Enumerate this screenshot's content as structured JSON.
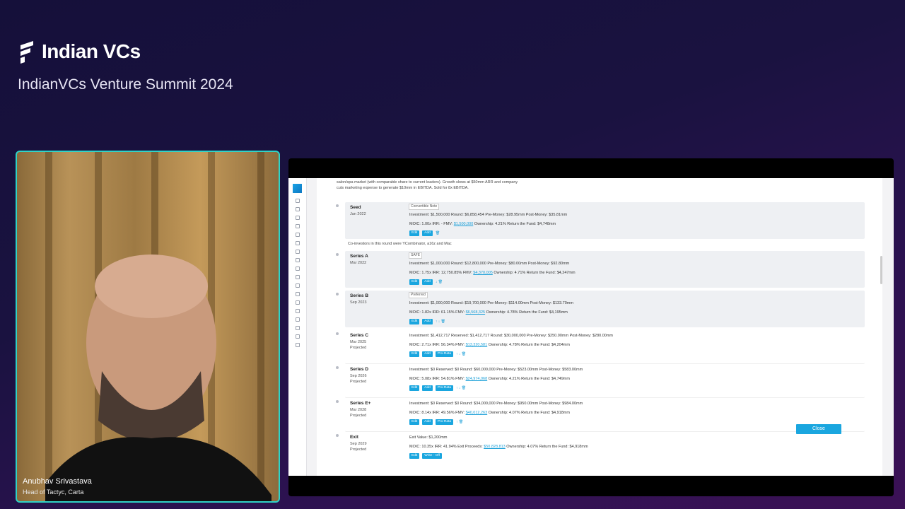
{
  "event": {
    "brand": "Indian VCs",
    "title": "IndianVCs Venture Summit 2024"
  },
  "speaker": {
    "name": "Anubhav Srivastava",
    "role": "Head of Tactyc, Carta"
  },
  "app": {
    "intro_line1": "salon/spa market (with comparable share to current leaders). Growth slows at $50mm ARR and company",
    "intro_line2": "cuts marketing expense to generate $10mm in EBITDA. Sold for 8x EBITDA.",
    "co_investors_note": "Co-investors in this round were YCombinator, a16z and Mac",
    "close_label": "Close",
    "rounds": [
      {
        "name": "Seed",
        "date": "Jan 2022",
        "badge": "Convertible Note",
        "line1": "Investment: $1,500,000   Round: $6,858,454   Pre-Money: $28.95mm   Post-Money: $35.81mm",
        "line2a": "MOIC: 1.00x   IRR: -   FMV: ",
        "fmv": "$1,500,000",
        "line2b": "   Ownership: 4.21%   Return the Fund: $4,748mm",
        "buttons": [
          "Edit",
          "Add"
        ],
        "icons": "🗑"
      },
      {
        "name": "Series A",
        "date": "Mar 2022",
        "badge": "SAFE",
        "line1": "Investment: $1,000,000   Round: $12,800,000   Pre-Money: $80.00mm   Post-Money: $92.80mm",
        "line2a": "MOIC: 1.75x   IRR: 12,750.85%   FMV: ",
        "fmv": "$4,370,005",
        "line2b": "   Ownership: 4.71%   Return the Fund: $4,247mm",
        "buttons": [
          "Edit",
          "Add"
        ],
        "icons": "↓ 🗑"
      },
      {
        "name": "Series B",
        "date": "Sep 2023",
        "badge": "Preferred",
        "line1": "Investment: $1,000,000   Round: $19,700,000   Pre-Money: $114.00mm   Post-Money: $133.70mm",
        "line2a": "MOIC: 1.82x   IRR: 61.15%   FMV: ",
        "fmv": "$6,568,325",
        "line2b": "   Ownership: 4.78%   Return the Fund: $4,195mm",
        "buttons": [
          "Edit",
          "Add"
        ],
        "icons": "↑ ↓ 🗑"
      },
      {
        "name": "Series C",
        "date": "Mar 2025",
        "projected": "Projected",
        "line1": "Investment: $1,412,717   Reserved: $1,412,717   Round: $30,000,000   Pre-Money: $250.00mm   Post-Money: $280.00mm",
        "line2a": "MOIC: 2.71x   IRR: 56.34%   FMV: ",
        "fmv": "$13,320,581",
        "line2b": "   Ownership: 4.78%   Return the Fund: $4,204mm",
        "buttons": [
          "Edit",
          "Add",
          "Pro-Rata"
        ],
        "icons": "↑ ↓ 🗑"
      },
      {
        "name": "Series D",
        "date": "Sep 2026",
        "projected": "Projected",
        "line1": "Investment: $0   Reserved: $0   Round: $60,000,000   Pre-Money: $523.00mm   Post-Money: $583.00mm",
        "line2a": "MOIC: 5.08x   IRR: 54.81%   FMV: ",
        "fmv": "$24,974,068",
        "line2b": "   Ownership: 4.21%   Return the Fund: $4,749mm",
        "buttons": [
          "Edit",
          "Add",
          "Pro-Rata"
        ],
        "icons": "↑ ↓ 🗑"
      },
      {
        "name": "Series E+",
        "date": "Mar 2028",
        "projected": "Projected",
        "line1": "Investment: $0   Reserved: $0   Round: $34,000,000   Pre-Money: $950.00mm   Post-Money: $984.00mm",
        "line2a": "MOIC: 8.14x   IRR: 49.56%   FMV: ",
        "fmv": "$40,012,263",
        "line2b": "   Ownership: 4.07%   Return the Fund: $4,918mm",
        "buttons": [
          "Edit",
          "Add",
          "Pro-Rata"
        ],
        "icons": "↑ 🗑"
      },
      {
        "name": "Exit",
        "date": "Sep 2029",
        "projected": "Projected",
        "line1": "Exit Value: $1,200mm",
        "line2a": "MOIC: 10.35x   IRR: 41.94%   Exit Proceeds: ",
        "fmv": "$50,828,813",
        "line2b": "   Ownership: 4.07%   Return the Fund: $4,918mm",
        "buttons": [
          "Edit",
          "Write - Off"
        ],
        "icons": ""
      }
    ]
  }
}
